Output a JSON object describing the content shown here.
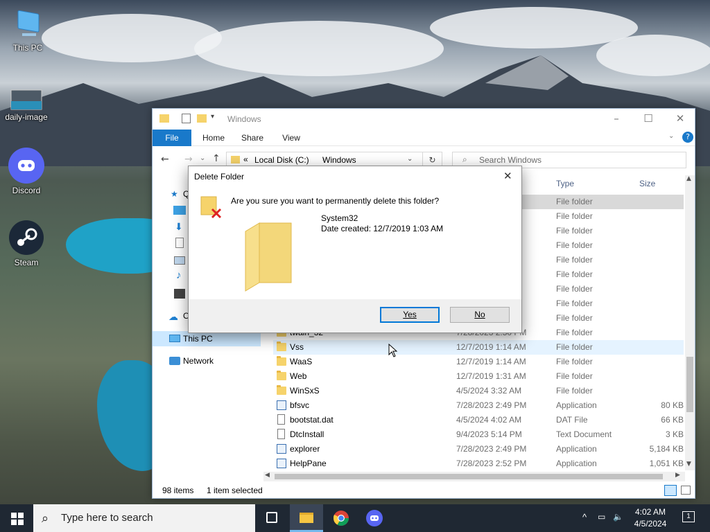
{
  "desktop": {
    "icons": [
      {
        "label": "This PC"
      },
      {
        "label": "daily-image"
      },
      {
        "label": "Discord"
      },
      {
        "label": "Steam"
      }
    ]
  },
  "explorer": {
    "title": "Windows",
    "ribbon_tabs": [
      "File",
      "Home",
      "Share",
      "View"
    ],
    "address": {
      "chevrons": "«",
      "segments": [
        "Local Disk (C:)",
        "Windows"
      ]
    },
    "search_placeholder": "Search Windows",
    "columns": {
      "type": "Type",
      "size": "Size"
    },
    "nav": {
      "quick_access_partial": "Q",
      "onedrive_partial": "O",
      "this_pc": "This PC",
      "network": "Network"
    },
    "rows": [
      {
        "name": "",
        "date": "",
        "type": "File folder",
        "size": ""
      },
      {
        "name": "",
        "date": "",
        "type": "File folder",
        "size": ""
      },
      {
        "name": "",
        "date": "",
        "type": "File folder",
        "size": ""
      },
      {
        "name": "",
        "date": "",
        "type": "File folder",
        "size": ""
      },
      {
        "name": "",
        "date": "",
        "type": "File folder",
        "size": ""
      },
      {
        "name": "",
        "date": "",
        "type": "File folder",
        "size": ""
      },
      {
        "name": "",
        "date": "",
        "type": "File folder",
        "size": ""
      },
      {
        "name": "",
        "date": "",
        "type": "File folder",
        "size": ""
      },
      {
        "name": "",
        "date": "",
        "type": "File folder",
        "size": ""
      },
      {
        "name": "twain_32",
        "date": "7/28/2023 2:50 PM",
        "type": "File folder",
        "size": ""
      },
      {
        "name": "Vss",
        "date": "12/7/2019 1:14 AM",
        "type": "File folder",
        "size": ""
      },
      {
        "name": "WaaS",
        "date": "12/7/2019 1:14 AM",
        "type": "File folder",
        "size": ""
      },
      {
        "name": "Web",
        "date": "12/7/2019 1:31 AM",
        "type": "File folder",
        "size": ""
      },
      {
        "name": "WinSxS",
        "date": "4/5/2024 3:32 AM",
        "type": "File folder",
        "size": ""
      },
      {
        "name": "bfsvc",
        "date": "7/28/2023 2:49 PM",
        "type": "Application",
        "size": "80 KB"
      },
      {
        "name": "bootstat.dat",
        "date": "4/5/2024 4:02 AM",
        "type": "DAT File",
        "size": "66 KB"
      },
      {
        "name": "DtcInstall",
        "date": "9/4/2023 5:14 PM",
        "type": "Text Document",
        "size": "3 KB"
      },
      {
        "name": "explorer",
        "date": "7/28/2023 2:49 PM",
        "type": "Application",
        "size": "5,184 KB"
      },
      {
        "name": "HelpPane",
        "date": "7/28/2023 2:52 PM",
        "type": "Application",
        "size": "1,051 KB"
      }
    ],
    "status": {
      "items": "98 items",
      "selected": "1 item selected"
    }
  },
  "dialog": {
    "title": "Delete Folder",
    "question": "Are you sure you want to permanently delete this folder?",
    "folder_name": "System32",
    "date_created": "Date created: 12/7/2019 1:03 AM",
    "yes": "Yes",
    "no": "No"
  },
  "taskbar": {
    "search_placeholder": "Type here to search",
    "time": "4:02 AM",
    "date": "4/5/2024",
    "notification_count": "1"
  }
}
